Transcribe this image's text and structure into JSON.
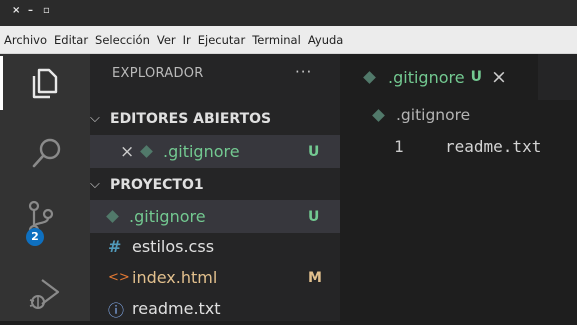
{
  "window": {
    "close": "×",
    "minimize": "–",
    "maximize": "▫"
  },
  "menu": [
    "Archivo",
    "Editar",
    "Selección",
    "Ver",
    "Ir",
    "Ejecutar",
    "Terminal",
    "Ayuda"
  ],
  "activity_bar": {
    "items": [
      "files-icon",
      "search-icon",
      "source-control-icon",
      "run-debug-icon"
    ],
    "source_control_badge": "2"
  },
  "explorer": {
    "title": "EXPLORADOR",
    "more": "···",
    "open_editors": {
      "title": "EDITORES ABIERTOS",
      "files": [
        {
          "name": ".gitignore",
          "status": "U"
        }
      ]
    },
    "project": {
      "title": "PROYECTO1",
      "files": [
        {
          "name": ".gitignore",
          "status": "U",
          "icon": "git-file-icon"
        },
        {
          "name": "estilos.css",
          "status": "",
          "icon": "css-file-icon",
          "glyph": "#"
        },
        {
          "name": "index.html",
          "status": "M",
          "icon": "html-file-icon",
          "glyph": "<>"
        },
        {
          "name": "readme.txt",
          "status": "",
          "icon": "info-file-icon",
          "glyph": "ⓘ"
        }
      ]
    }
  },
  "editor": {
    "tab": {
      "name": ".gitignore",
      "status": "U",
      "close": "×"
    },
    "breadcrumb": ".gitignore",
    "lines": [
      {
        "number": "1",
        "text": "readme.txt"
      }
    ]
  },
  "colors": {
    "git_untracked": "#73c991",
    "git_modified": "#e2c08d",
    "badge": "#0e70c0",
    "css_icon": "#519aba",
    "html_icon": "#e37933",
    "info_icon": "#8ab4f8"
  }
}
